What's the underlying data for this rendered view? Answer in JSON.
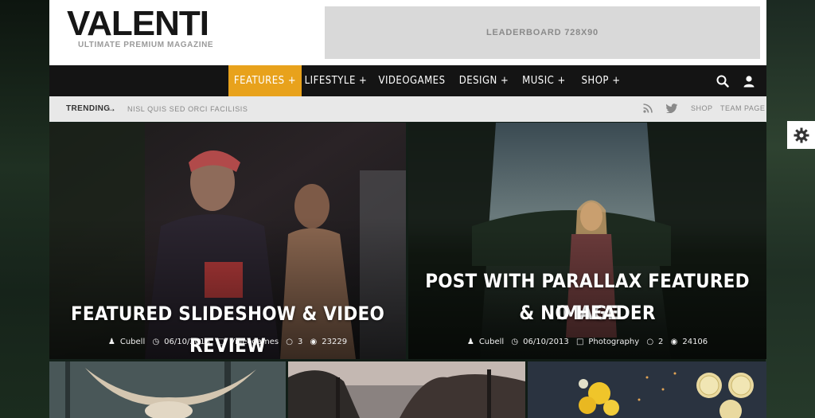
{
  "site": {
    "logo": "VALENTI",
    "tagline": "ULTIMATE PREMIUM MAGAZINE",
    "leaderboard": "LEADERBOARD 728X90"
  },
  "nav": {
    "items": [
      {
        "label": "FEATURES +",
        "active": true
      },
      {
        "label": "LIFESTYLE +"
      },
      {
        "label": "VIDEOGAMES"
      },
      {
        "label": "DESIGN +"
      },
      {
        "label": "MUSIC +"
      },
      {
        "label": "SHOP +"
      }
    ],
    "icons": [
      "search-icon",
      "user-icon"
    ],
    "accent": "#e8a21c"
  },
  "trending": {
    "label": "TRENDING",
    "arrow": "→",
    "text": "NISL QUIS SED ORCI FACILISIS",
    "links": [
      "SHOP",
      "TEAM PAGE"
    ],
    "icons": [
      "rss-icon",
      "twitter-icon"
    ]
  },
  "features": [
    {
      "title_line1": "FEATURED SLIDESHOW & VIDEO REVIEW",
      "author": "Cubell",
      "date": "06/10/2013",
      "category": "Videogames",
      "comments": "3",
      "views": "23229"
    },
    {
      "title_line1": "POST WITH PARALLAX FEATURED IMAGE",
      "title_line2": "& NO HEADER",
      "author": "Cubell",
      "date": "06/10/2013",
      "category": "Photography",
      "comments": "2",
      "views": "24106"
    }
  ],
  "thumbs": [
    "skull-horns-thumb",
    "forest-trees-thumb",
    "flowers-lemons-thumb"
  ]
}
